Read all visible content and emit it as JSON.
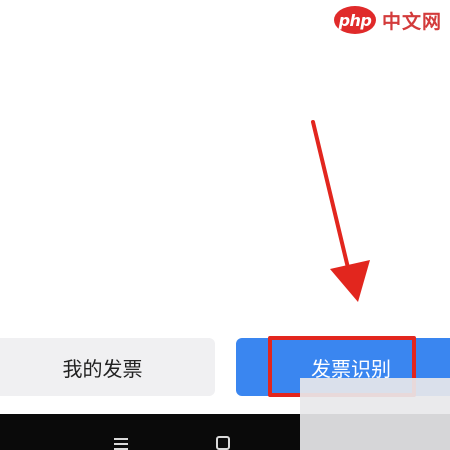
{
  "watermark": {
    "logo_text": "php",
    "site_text": "中文网"
  },
  "buttons": {
    "my_invoices": "我的发票",
    "invoice_recognition": "发票识别"
  },
  "annotation": {
    "color": "#e2261e"
  },
  "nav": {
    "menu_icon": "menu-icon",
    "home_icon": "home-icon"
  }
}
